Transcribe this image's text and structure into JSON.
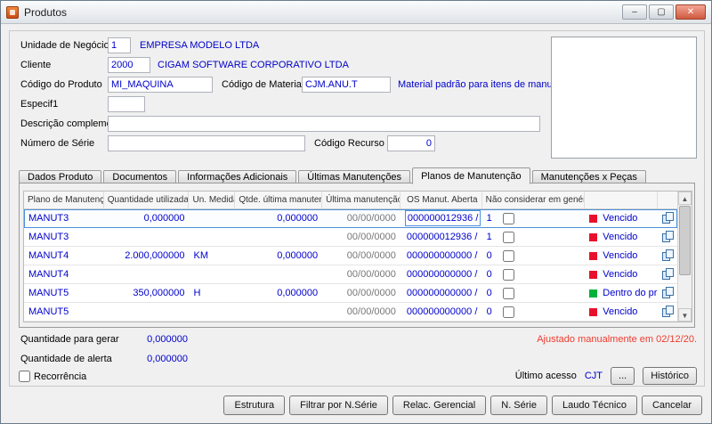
{
  "window": {
    "title": "Produtos",
    "controls": {
      "minimize": "–",
      "maximize": "▢",
      "close": "✕"
    }
  },
  "form": {
    "unidade_negocio": {
      "label": "Unidade de Negócio",
      "value": "1",
      "description": "EMPRESA MODELO LTDA"
    },
    "cliente": {
      "label": "Cliente",
      "value": "2000",
      "description": "CIGAM SOFTWARE CORPORATIVO LTDA"
    },
    "codigo_produto": {
      "label": "Código do Produto",
      "value": "MI_MAQUINA"
    },
    "codigo_material": {
      "label": "Código de Material",
      "value": "CJM.ANU.T",
      "description": "Material padrão para itens de manutenção"
    },
    "especif1": {
      "label": "Especif1",
      "value": ""
    },
    "descricao_complementar": {
      "label": "Descrição complementar",
      "value": ""
    },
    "numero_serie": {
      "label": "Número de Série",
      "value": ""
    },
    "codigo_recurso": {
      "label": "Código Recurso",
      "value": "0"
    }
  },
  "tabs": [
    {
      "label": "Dados Produto",
      "active": false
    },
    {
      "label": "Documentos",
      "active": false
    },
    {
      "label": "Informações Adicionais",
      "active": false
    },
    {
      "label": "Últimas Manutenções",
      "active": false
    },
    {
      "label": "Planos de Manutenção",
      "active": true
    },
    {
      "label": "Manutenções x Peças",
      "active": false
    }
  ],
  "table": {
    "columns": {
      "plano": "Plano de Manutenção",
      "qtd_utilizada": "Quantidade utilizada",
      "un": "Un. Medida",
      "qtde_ultima": "Qtde. última manuten...",
      "ultima_manut": "Última manutenção",
      "os": "OS Manut. Aberta",
      "nao": "Não considerar em genérico",
      "status": "",
      "copy": ""
    },
    "rows": [
      {
        "plano": "MANUT3",
        "qtd_utilizada": "0,000000",
        "un": "",
        "qtde_ultima": "0,000000",
        "ultima_manut": "00/00/0000",
        "os": "000000012936 /",
        "os_count": "1",
        "nao_considerar": false,
        "status": "Vencido",
        "status_color": "#e8112d",
        "selected": true
      },
      {
        "plano": "MANUT3",
        "qtd_utilizada": "",
        "un": "",
        "qtde_ultima": "",
        "ultima_manut": "00/00/0000",
        "os": "000000012936 /",
        "os_count": "1",
        "nao_considerar": false,
        "status": "Vencido",
        "status_color": "#e8112d",
        "selected": false
      },
      {
        "plano": "MANUT4",
        "qtd_utilizada": "2.000,000000",
        "un": "KM",
        "qtde_ultima": "0,000000",
        "ultima_manut": "00/00/0000",
        "os": "000000000000 /",
        "os_count": "0",
        "nao_considerar": false,
        "status": "Vencido",
        "status_color": "#e8112d",
        "selected": false
      },
      {
        "plano": "MANUT4",
        "qtd_utilizada": "",
        "un": "",
        "qtde_ultima": "",
        "ultima_manut": "00/00/0000",
        "os": "000000000000 /",
        "os_count": "0",
        "nao_considerar": false,
        "status": "Vencido",
        "status_color": "#e8112d",
        "selected": false
      },
      {
        "plano": "MANUT5",
        "qtd_utilizada": "350,000000",
        "un": "H",
        "qtde_ultima": "0,000000",
        "ultima_manut": "00/00/0000",
        "os": "000000000000 /",
        "os_count": "0",
        "nao_considerar": false,
        "status": "Dentro do prazo",
        "status_color": "#00b23a",
        "selected": false
      },
      {
        "plano": "MANUT5",
        "qtd_utilizada": "",
        "un": "",
        "qtde_ultima": "",
        "ultima_manut": "00/00/0000",
        "os": "000000000000 /",
        "os_count": "0",
        "nao_considerar": false,
        "status": "Vencido",
        "status_color": "#e8112d",
        "selected": false
      }
    ]
  },
  "footer": {
    "quantidade_gerar": {
      "label": "Quantidade para gerar",
      "value": "0,000000"
    },
    "quantidade_alerta": {
      "label": "Quantidade de alerta",
      "value": "0,000000"
    },
    "recorrencia_label": "Recorrência",
    "ajuste_note": "Ajustado manualmente em 02/12/20.",
    "ultimo_acesso_label": "Último acesso",
    "ultimo_acesso_value": "CJT",
    "ellipsis_button": "...",
    "historico_button": "Histórico"
  },
  "actions": {
    "estrutura": "Estrutura",
    "filtrar": "Filtrar por N.Série",
    "relac": "Relac. Gerencial",
    "nserie": "N. Série",
    "laudo": "Laudo Técnico",
    "cancelar": "Cancelar"
  },
  "colors": {
    "value_blue": "#0000cc",
    "status_red": "#e8112d",
    "status_green": "#00b23a",
    "note_red": "#f03b2e",
    "selection_blue": "#4d90d9"
  }
}
